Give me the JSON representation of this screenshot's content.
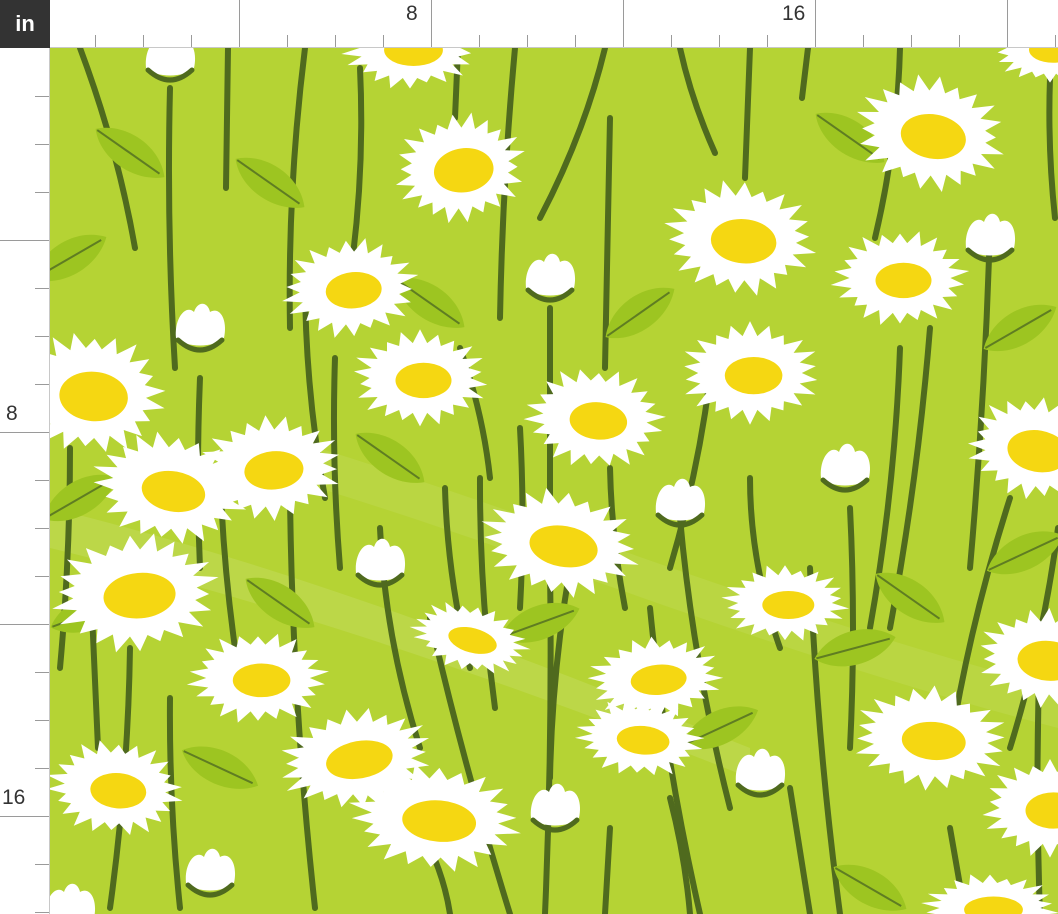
{
  "ruler": {
    "unit": "in",
    "top_labels": [
      "8",
      "16"
    ],
    "left_labels": [
      "8",
      "16"
    ]
  },
  "fabric": {
    "pattern": "daisies",
    "colors": {
      "background": "#b5d334",
      "stem": "#4f6a1e",
      "leaf": "#9dc521",
      "leaf_vein": "#5f7d22",
      "petal": "#ffffff",
      "center": "#f5d712"
    }
  }
}
